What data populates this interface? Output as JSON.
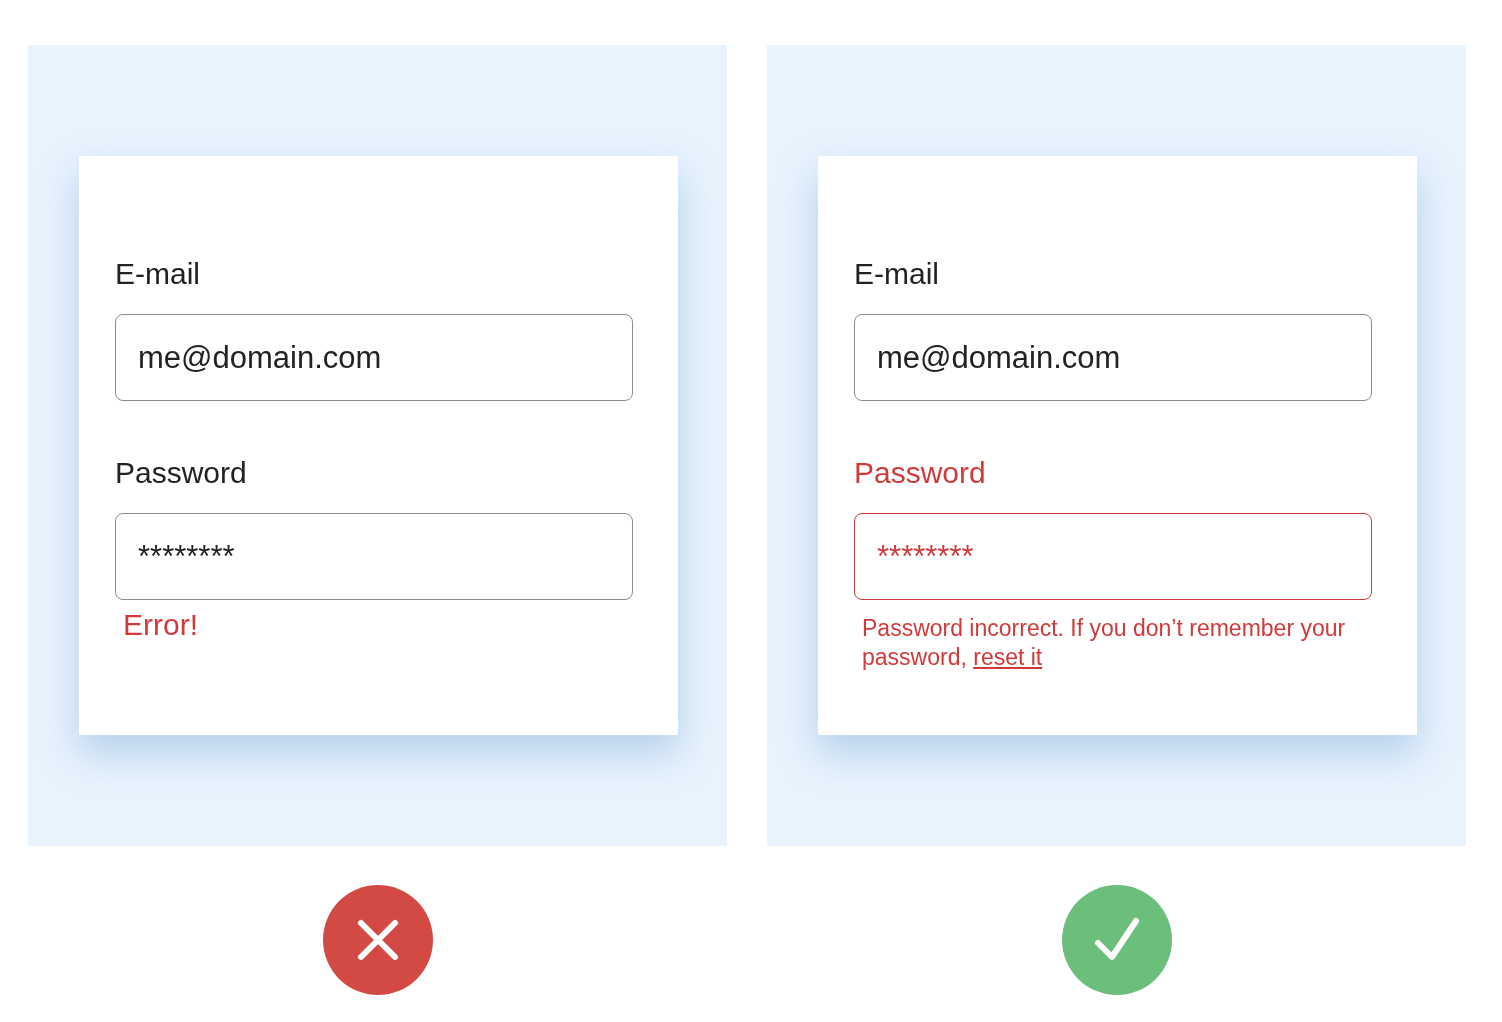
{
  "examples": [
    {
      "kind": "wrong",
      "fields": [
        {
          "label": "E-mail",
          "value": "me@domain.com",
          "invalid": false
        },
        {
          "label": "Password",
          "value": "********",
          "invalid": false
        }
      ],
      "error": {
        "kind": "short",
        "text": "Error!"
      }
    },
    {
      "kind": "right",
      "fields": [
        {
          "label": "E-mail",
          "value": "me@domain.com",
          "invalid": false
        },
        {
          "label": "Password",
          "value": "********",
          "invalid": true
        }
      ],
      "error": {
        "kind": "detailed",
        "text": "Password incorrect. If you don’t remember your password,",
        "link": "reset it"
      }
    }
  ]
}
